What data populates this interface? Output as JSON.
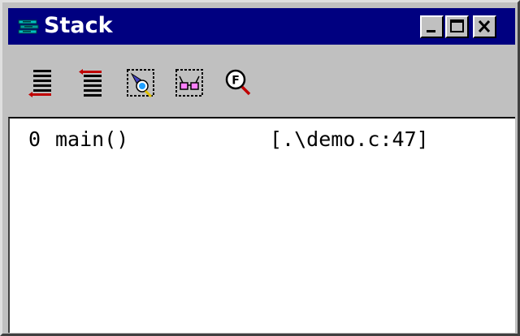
{
  "window": {
    "title": "Stack",
    "colors": {
      "titlebar": "#000080",
      "face": "#c0c0c0",
      "content": "#ffffff"
    }
  },
  "titlebar_buttons": [
    "minimize-icon",
    "maximize-icon",
    "close-icon"
  ],
  "toolbar": {
    "tools": [
      {
        "icon": "stack-up-icon"
      },
      {
        "icon": "stack-down-icon"
      },
      {
        "icon": "flashlight-icon"
      },
      {
        "icon": "glasses-icon"
      },
      {
        "icon": "find-function-icon"
      }
    ]
  },
  "stack": {
    "frames": [
      {
        "index": "0",
        "function": "main()",
        "location": "[.\\demo.c:47]"
      }
    ]
  }
}
